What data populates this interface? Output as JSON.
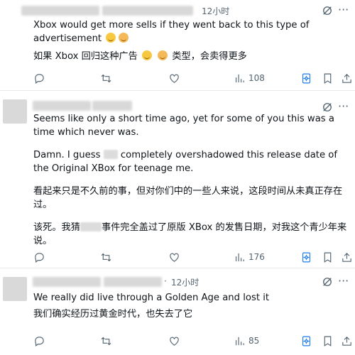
{
  "posts": [
    {
      "time": "12小时",
      "paragraphs": [
        {
          "segments": [
            {
              "text": "Xbox would get more sells if they went back to this type of advertisement"
            }
          ],
          "emojis_after": [
            "smile-emoji",
            "blush-emoji"
          ]
        },
        {
          "segments": [
            {
              "text": "如果 Xbox 回归这种广告"
            }
          ],
          "mid_emojis": [
            "smile-emoji",
            "blush-emoji"
          ],
          "tail": "类型，会卖得更多"
        }
      ],
      "actions": {
        "views": "108"
      }
    },
    {
      "paragraphs": [
        "Seems like only a short time ago, yet for some of you this was a time which never was.",
        {
          "before": "Damn. I guess",
          "after": "completely overshadowed this release date of the Original XBox for teenage me."
        },
        "看起来只是不久前的事，但对你们中的一些人来说，这段时间从未真正存在过。",
        {
          "before": "该死。我猜",
          "after": "事件完全盖过了原版 XBox 的发售日期，对我这个青少年来说。"
        }
      ],
      "actions": {
        "views": "176"
      }
    },
    {
      "separator": "·",
      "time": "12小时",
      "paragraphs": [
        "We really did live through a Golden Age and lost it",
        "我们确实经历过黄金时代，也失去了它"
      ],
      "actions": {
        "views": "85"
      }
    }
  ],
  "icons": {
    "accent": "#1d7df0",
    "text_secondary": "#536471"
  }
}
